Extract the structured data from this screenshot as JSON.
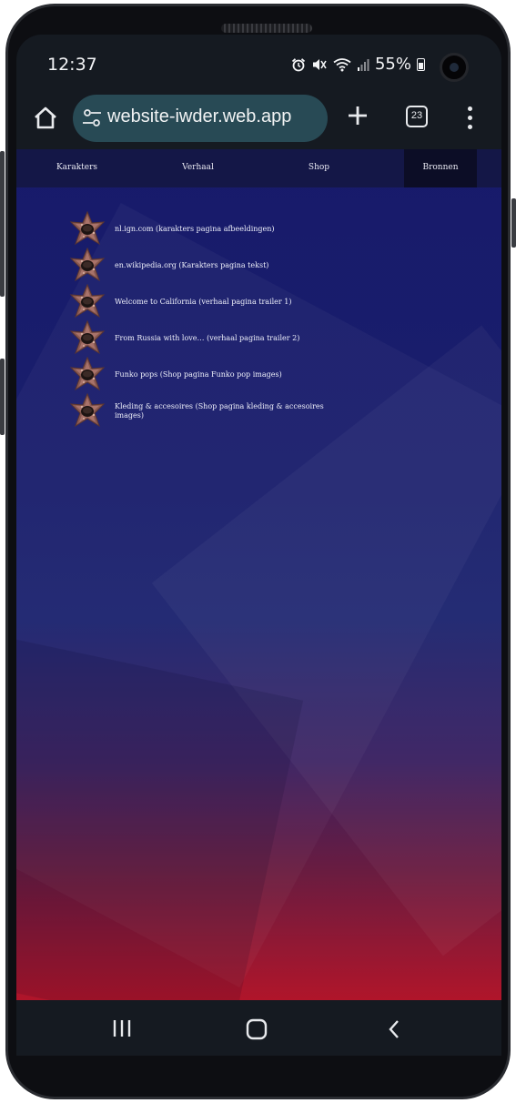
{
  "status_bar": {
    "time": "12:37",
    "battery_percent": "55%",
    "icons": [
      "alarm-icon",
      "mute-icon",
      "wifi-icon",
      "signal-icon",
      "battery-icon"
    ]
  },
  "browser": {
    "url": "website-iwder.web.app",
    "tab_count": "23",
    "icons": [
      "home-icon",
      "site-settings-icon",
      "new-tab-icon",
      "tabs-icon",
      "more-menu-icon"
    ],
    "pill_color": "#284a55"
  },
  "site": {
    "nav": [
      "Karakters",
      "Verhaal",
      "Shop",
      "Bronnen"
    ],
    "active_nav": "Bronnen",
    "sources": [
      "nl.ign.com (karakters pagina afbeeldingen)",
      "en.wikipedia.org (Karakters pagina tekst)",
      "Welcome to California (verhaal pagina trailer 1)",
      "From Russia with love… (verhaal pagina trailer 2)",
      "Funko pops (Shop pagina Funko pop images)",
      "Kleding & accesoires (Shop pagina kleding & accesoires images)"
    ],
    "bullet_icon": "demogorgon-flower-icon",
    "colors": {
      "nav_bg": "#141747",
      "page_top": "#171a6b",
      "page_bottom": "#b0152a"
    }
  },
  "system_nav": {
    "icons": [
      "recents-icon",
      "home-nav-icon",
      "back-icon"
    ]
  }
}
